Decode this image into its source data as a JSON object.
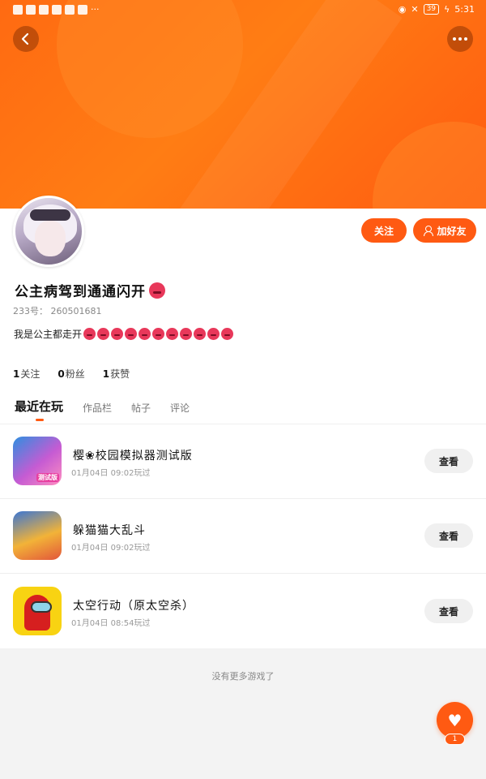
{
  "status_bar": {
    "battery": "39",
    "time": "5:31"
  },
  "profile": {
    "follow_label": "关注",
    "add_friend_label": "加好友",
    "nickname": "公主病驾到通通闪开",
    "uid": "233号： 260501681",
    "bio": "我是公主都走开",
    "bio_emoji_count": 11,
    "stats": [
      {
        "value": "1",
        "label": "关注"
      },
      {
        "value": "0",
        "label": "粉丝"
      },
      {
        "value": "1",
        "label": "获赞"
      }
    ]
  },
  "tabs": [
    {
      "label": "最近在玩",
      "active": true
    },
    {
      "label": "作品栏",
      "active": false
    },
    {
      "label": "帖子",
      "active": false
    },
    {
      "label": "评论",
      "active": false
    }
  ],
  "games": [
    {
      "title": "樱❀校园模拟器测试版",
      "time": "01月04日 09:02玩过",
      "view_label": "查看",
      "badge": "测试版"
    },
    {
      "title": "躲猫猫大乱斗",
      "time": "01月04日 09:02玩过",
      "view_label": "查看"
    },
    {
      "title": "太空行动（原太空杀）",
      "time": "01月04日 08:54玩过",
      "view_label": "查看"
    }
  ],
  "footer_text": "没有更多游戏了",
  "like_count": "1",
  "colors": {
    "accent": "#ff5a12",
    "banner": "#ff6a12"
  }
}
